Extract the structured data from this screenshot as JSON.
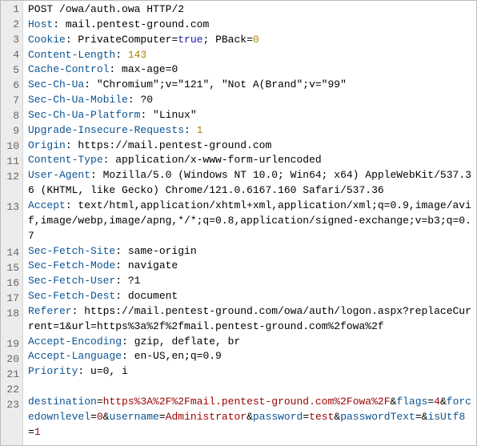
{
  "request": {
    "lines": [
      {
        "n": 1,
        "segments": [
          {
            "t": "POST",
            "c": "val"
          },
          {
            "t": " /owa/auth.owa ",
            "c": "val"
          },
          {
            "t": "HTTP/2",
            "c": "val"
          }
        ]
      },
      {
        "n": 2,
        "segments": [
          {
            "t": "Host",
            "c": "hdr"
          },
          {
            "t": ": ",
            "c": "val"
          },
          {
            "t": "mail.pentest-ground.com",
            "c": "val"
          }
        ]
      },
      {
        "n": 3,
        "segments": [
          {
            "t": "Cookie",
            "c": "hdr"
          },
          {
            "t": ": ",
            "c": "val"
          },
          {
            "t": "PrivateComputer=",
            "c": "val"
          },
          {
            "t": "true",
            "c": "lit"
          },
          {
            "t": "; PBack=",
            "c": "val"
          },
          {
            "t": "0",
            "c": "num"
          }
        ]
      },
      {
        "n": 4,
        "segments": [
          {
            "t": "Content-Length",
            "c": "hdr"
          },
          {
            "t": ": ",
            "c": "val"
          },
          {
            "t": "143",
            "c": "num"
          }
        ]
      },
      {
        "n": 5,
        "segments": [
          {
            "t": "Cache-Control",
            "c": "hdr"
          },
          {
            "t": ": ",
            "c": "val"
          },
          {
            "t": "max-age=0",
            "c": "val"
          }
        ]
      },
      {
        "n": 6,
        "segments": [
          {
            "t": "Sec-Ch-Ua",
            "c": "hdr"
          },
          {
            "t": ": ",
            "c": "val"
          },
          {
            "t": "\"Chromium\";v=\"121\", \"Not A(Brand\";v=\"99\"",
            "c": "val"
          }
        ]
      },
      {
        "n": 7,
        "segments": [
          {
            "t": "Sec-Ch-Ua-Mobile",
            "c": "hdr"
          },
          {
            "t": ": ",
            "c": "val"
          },
          {
            "t": "?0",
            "c": "val"
          }
        ]
      },
      {
        "n": 8,
        "segments": [
          {
            "t": "Sec-Ch-Ua-Platform",
            "c": "hdr"
          },
          {
            "t": ": ",
            "c": "val"
          },
          {
            "t": "\"Linux\"",
            "c": "val"
          }
        ]
      },
      {
        "n": 9,
        "segments": [
          {
            "t": "Upgrade-Insecure-Requests",
            "c": "hdr"
          },
          {
            "t": ": ",
            "c": "val"
          },
          {
            "t": "1",
            "c": "num"
          }
        ]
      },
      {
        "n": 10,
        "segments": [
          {
            "t": "Origin",
            "c": "hdr"
          },
          {
            "t": ": ",
            "c": "val"
          },
          {
            "t": "https://mail.pentest-ground.com",
            "c": "val"
          }
        ]
      },
      {
        "n": 11,
        "segments": [
          {
            "t": "Content-Type",
            "c": "hdr"
          },
          {
            "t": ": ",
            "c": "val"
          },
          {
            "t": "application/x-www-form-urlencoded",
            "c": "val"
          }
        ]
      },
      {
        "n": 12,
        "segments": [
          {
            "t": "User-Agent",
            "c": "hdr"
          },
          {
            "t": ": ",
            "c": "val"
          },
          {
            "t": "Mozilla/5.0 (Windows NT 10.0; Win64; x64) AppleWebKit/537.36 (KHTML, like Gecko) Chrome/121.0.6167.160 Safari/537.36",
            "c": "val"
          }
        ]
      },
      {
        "n": 13,
        "segments": [
          {
            "t": "Accept",
            "c": "hdr"
          },
          {
            "t": ": ",
            "c": "val"
          },
          {
            "t": "text/html,application/xhtml+xml,application/xml;q=0.9,image/avif,image/webp,image/apng,*/*;q=0.8,application/signed-exchange;v=b3;q=0.7",
            "c": "val"
          }
        ]
      },
      {
        "n": 14,
        "segments": [
          {
            "t": "Sec-Fetch-Site",
            "c": "hdr"
          },
          {
            "t": ": ",
            "c": "val"
          },
          {
            "t": "same-origin",
            "c": "val"
          }
        ]
      },
      {
        "n": 15,
        "segments": [
          {
            "t": "Sec-Fetch-Mode",
            "c": "hdr"
          },
          {
            "t": ": ",
            "c": "val"
          },
          {
            "t": "navigate",
            "c": "val"
          }
        ]
      },
      {
        "n": 16,
        "segments": [
          {
            "t": "Sec-Fetch-User",
            "c": "hdr"
          },
          {
            "t": ": ",
            "c": "val"
          },
          {
            "t": "?1",
            "c": "val"
          }
        ]
      },
      {
        "n": 17,
        "segments": [
          {
            "t": "Sec-Fetch-Dest",
            "c": "hdr"
          },
          {
            "t": ": ",
            "c": "val"
          },
          {
            "t": "document",
            "c": "val"
          }
        ]
      },
      {
        "n": 18,
        "segments": [
          {
            "t": "Referer",
            "c": "hdr"
          },
          {
            "t": ": ",
            "c": "val"
          },
          {
            "t": "https://mail.pentest-ground.com/owa/auth/logon.aspx?replaceCurrent=1&url=https%3a%2f%2fmail.pentest-ground.com%2fowa%2f",
            "c": "val"
          }
        ]
      },
      {
        "n": 19,
        "segments": [
          {
            "t": "Accept-Encoding",
            "c": "hdr"
          },
          {
            "t": ": ",
            "c": "val"
          },
          {
            "t": "gzip, deflate, br",
            "c": "val"
          }
        ]
      },
      {
        "n": 20,
        "segments": [
          {
            "t": "Accept-Language",
            "c": "hdr"
          },
          {
            "t": ": ",
            "c": "val"
          },
          {
            "t": "en-US,en;q=0.9",
            "c": "val"
          }
        ]
      },
      {
        "n": 21,
        "segments": [
          {
            "t": "Priority",
            "c": "hdr"
          },
          {
            "t": ": ",
            "c": "val"
          },
          {
            "t": "u=0, i",
            "c": "val"
          }
        ]
      },
      {
        "n": 22,
        "segments": []
      },
      {
        "n": 23,
        "segments": [
          {
            "t": "destination",
            "c": "pname"
          },
          {
            "t": "=",
            "c": "val"
          },
          {
            "t": "https%3A%2F%2Fmail.pentest-ground.com%2Fowa%2F",
            "c": "pval"
          },
          {
            "t": "&",
            "c": "val"
          },
          {
            "t": "flags",
            "c": "pname"
          },
          {
            "t": "=",
            "c": "val"
          },
          {
            "t": "4",
            "c": "pval"
          },
          {
            "t": "&",
            "c": "val"
          },
          {
            "t": "forcedownlevel",
            "c": "pname"
          },
          {
            "t": "=",
            "c": "val"
          },
          {
            "t": "0",
            "c": "pval"
          },
          {
            "t": "&",
            "c": "val"
          },
          {
            "t": "username",
            "c": "pname"
          },
          {
            "t": "=",
            "c": "val"
          },
          {
            "t": "Administrator",
            "c": "pval"
          },
          {
            "t": "&",
            "c": "val"
          },
          {
            "t": "password",
            "c": "pname"
          },
          {
            "t": "=",
            "c": "val"
          },
          {
            "t": "test",
            "c": "pval"
          },
          {
            "t": "&",
            "c": "val"
          },
          {
            "t": "passwordText",
            "c": "pname"
          },
          {
            "t": "=",
            "c": "val"
          },
          {
            "t": "&",
            "c": "val"
          },
          {
            "t": "isUtf8",
            "c": "pname"
          },
          {
            "t": "=",
            "c": "val"
          },
          {
            "t": "1",
            "c": "pval"
          }
        ]
      }
    ]
  }
}
